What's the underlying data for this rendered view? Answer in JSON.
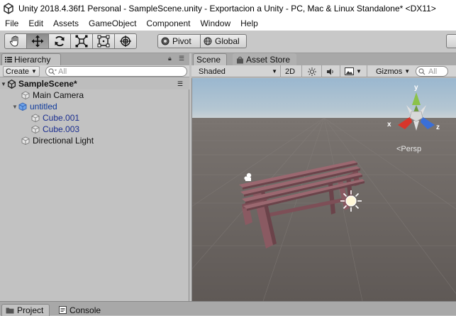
{
  "window": {
    "title": "Unity 2018.4.36f1 Personal - SampleScene.unity - Exportacion a Unity - PC, Mac & Linux Standalone* <DX11>"
  },
  "menu": [
    "File",
    "Edit",
    "Assets",
    "GameObject",
    "Component",
    "Window",
    "Help"
  ],
  "toolbar": {
    "tools": [
      "hand-tool",
      "move-tool",
      "rotate-tool",
      "scale-tool",
      "rect-tool",
      "transform-tool"
    ],
    "active_tool": "move-tool",
    "pivot_label": "Pivot",
    "global_label": "Global"
  },
  "hierarchy": {
    "tab_label": "Hierarchy",
    "create_label": "Create",
    "search_placeholder": "All",
    "scene_name": "SampleScene*",
    "items": [
      {
        "label": "Main Camera",
        "depth": 0,
        "expandable": false
      },
      {
        "label": "untitled",
        "depth": 0,
        "expandable": true
      },
      {
        "label": "Cube.001",
        "depth": 1,
        "expandable": false
      },
      {
        "label": "Cube.003",
        "depth": 1,
        "expandable": false
      },
      {
        "label": "Directional Light",
        "depth": 0,
        "expandable": false
      }
    ]
  },
  "scene": {
    "tabs": [
      {
        "label": "Scene",
        "active": true
      },
      {
        "label": "Asset Store",
        "active": false
      }
    ],
    "shading_mode": "Shaded",
    "mode_2d_label": "2D",
    "gizmos_label": "Gizmos",
    "search_placeholder": "All",
    "projection_label": "<Persp",
    "axis_labels": {
      "x": "x",
      "y": "y",
      "z": "z"
    },
    "colors": {
      "sky": "#a9c2d6",
      "ground": "#6f6864",
      "bench": "#8a5a62",
      "x_axis": "#d8352a",
      "y_axis": "#8bc24a",
      "z_axis": "#3a6fd8"
    }
  },
  "bottom_tabs": [
    {
      "label": "Project",
      "active": true
    },
    {
      "label": "Console",
      "active": false
    }
  ]
}
